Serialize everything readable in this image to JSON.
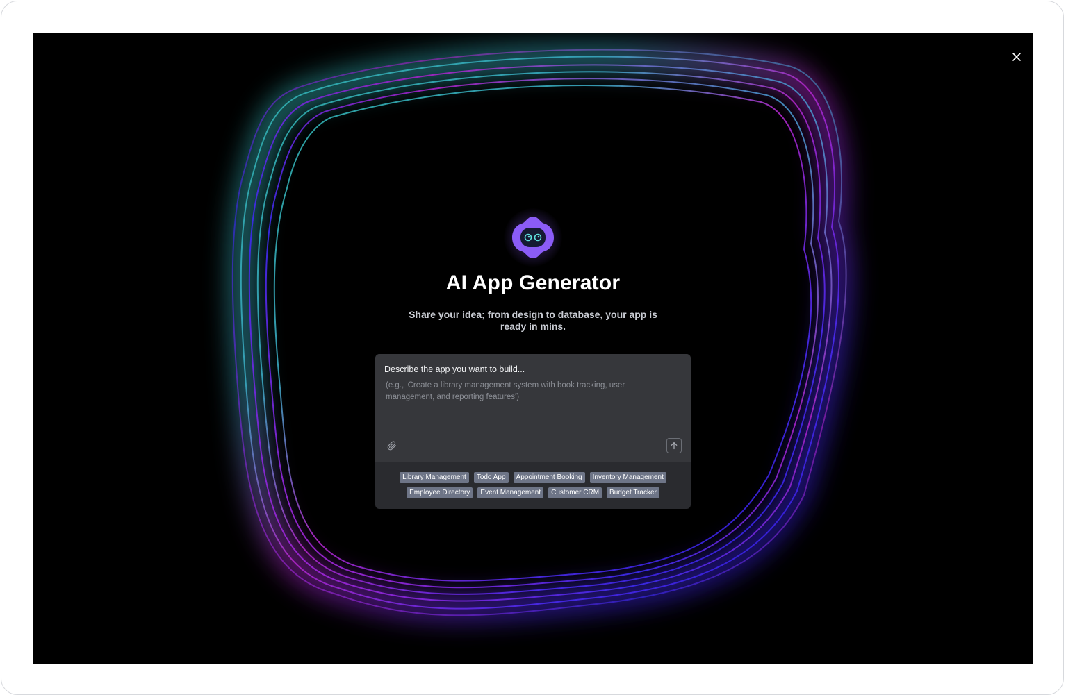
{
  "app": {
    "title": "AI App Generator",
    "subtitle": "Share your idea; from design to database, your app is ready in mins."
  },
  "prompt": {
    "label": "Describe the app you want to build...",
    "placeholder": "(e.g., 'Create a library management system with book tracking, user management, and reporting features')",
    "value": ""
  },
  "icons": {
    "close": "close-icon",
    "attach": "paperclip-icon",
    "send": "arrow-up-icon",
    "logo": "robot-logo-icon"
  },
  "suggestions": {
    "row1": [
      "Library Management",
      "Todo App",
      "Appointment Booking",
      "Inventory Management"
    ],
    "row2": [
      "Employee Directory",
      "Event Management",
      "Customer CRM",
      "Budget Tracker"
    ]
  },
  "colors": {
    "background": "#000000",
    "card": "#36373b",
    "chip": "#6e7587",
    "logo": "#8b5cf6",
    "wave_teal": "#2fb5b0",
    "wave_magenta": "#c026d3",
    "wave_blue": "#3b2bf0"
  }
}
